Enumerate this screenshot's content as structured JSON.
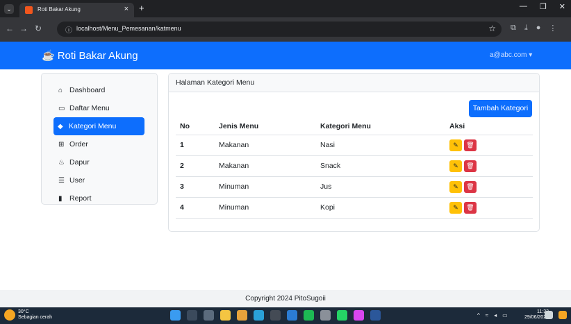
{
  "browser": {
    "tab_title": "Roti Bakar Akung",
    "tab_close": "×",
    "new_tab": "+",
    "url": "localhost/Menu_Pemesanan/katmenu"
  },
  "navbar": {
    "brand": "Roti Bakar Akung",
    "user": "a@abc.com ▾"
  },
  "sidebar": {
    "items": [
      {
        "label": "Dashboard",
        "icon": "house-icon",
        "active": false
      },
      {
        "label": "Daftar Menu",
        "icon": "book-icon",
        "active": false
      },
      {
        "label": "Kategori Menu",
        "icon": "tag-icon",
        "active": true
      },
      {
        "label": "Order",
        "icon": "cart-icon",
        "active": false
      },
      {
        "label": "Dapur",
        "icon": "fire-icon",
        "active": false
      },
      {
        "label": "User",
        "icon": "list-icon",
        "active": false
      },
      {
        "label": "Report",
        "icon": "bar-chart-icon",
        "active": false
      }
    ]
  },
  "main": {
    "card_title": "Halaman Kategori Menu",
    "add_button": "Tambah Kategori",
    "columns": {
      "no": "No",
      "jenis": "Jenis Menu",
      "kategori": "Kategori Menu",
      "aksi": "Aksi"
    },
    "rows": [
      {
        "no": "1",
        "jenis": "Makanan",
        "kategori": "Nasi"
      },
      {
        "no": "2",
        "jenis": "Makanan",
        "kategori": "Snack"
      },
      {
        "no": "3",
        "jenis": "Minuman",
        "kategori": "Jus"
      },
      {
        "no": "4",
        "jenis": "Minuman",
        "kategori": "Kopi"
      }
    ]
  },
  "footer": {
    "text": "Copyright 2024 PitoSugoii"
  },
  "taskbar": {
    "temperature": "30°C",
    "weather": "Sebagian cerah",
    "time": "11:33",
    "date": "29/06/2024"
  },
  "colors": {
    "primary": "#0d6efd",
    "edit": "#ffc107",
    "delete": "#dc3545"
  }
}
